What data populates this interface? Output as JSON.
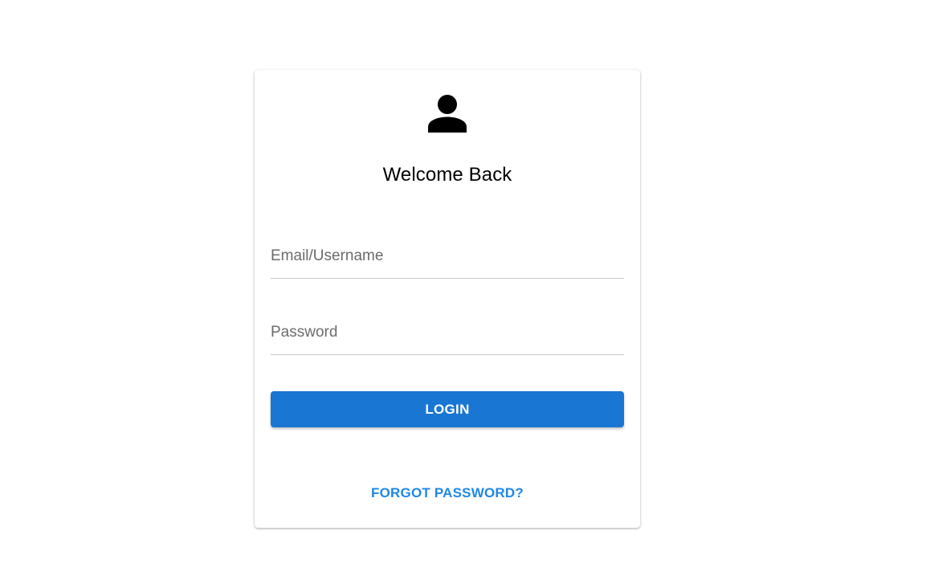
{
  "login_card": {
    "title": "Welcome Back",
    "avatar_icon": "person-icon",
    "email_placeholder": "Email/Username",
    "email_value": "",
    "password_placeholder": "Password",
    "password_value": "",
    "login_label": "LOGIN",
    "forgot_label": "FORGOT PASSWORD?"
  },
  "colors": {
    "primary": "#1976d2",
    "link": "#1e88e5",
    "text": "#000000",
    "placeholder": "#6b6b6b",
    "divider": "#c6c6c6"
  }
}
